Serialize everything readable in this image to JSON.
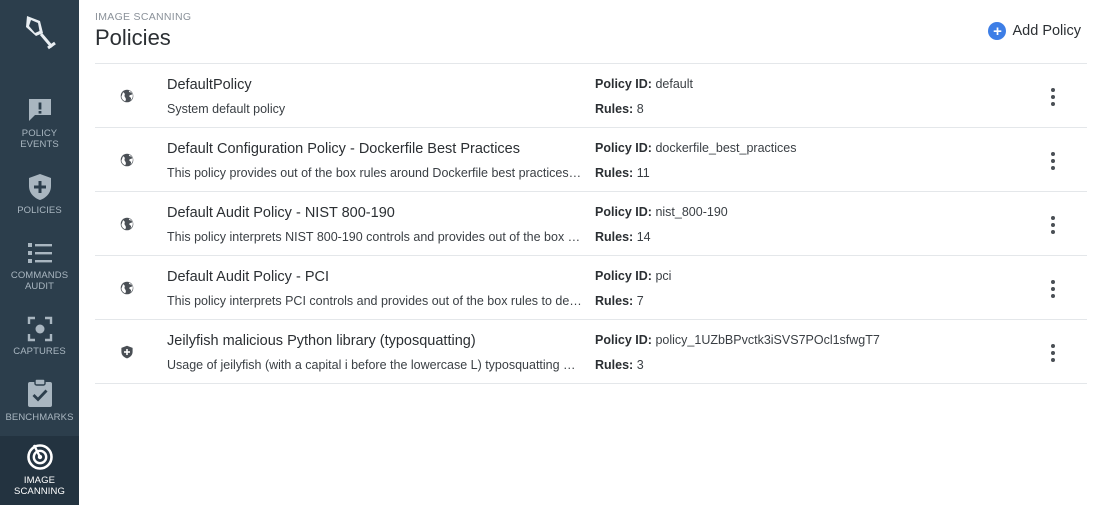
{
  "sidebar": {
    "items": [
      {
        "label": "Policy\nEvents",
        "icon": "chat-alert-icon"
      },
      {
        "label": "Policies",
        "icon": "shield-plus-icon"
      },
      {
        "label": "Commands\nAudit",
        "icon": "list-icon"
      },
      {
        "label": "Captures",
        "icon": "capture-focus-icon"
      },
      {
        "label": "Benchmarks",
        "icon": "clipboard-check-icon"
      },
      {
        "label": "Image\nScanning",
        "icon": "radar-icon",
        "active": true
      }
    ]
  },
  "header": {
    "breadcrumb": "IMAGE SCANNING",
    "title": "Policies",
    "add_label": "Add Policy"
  },
  "labels": {
    "policy_id": "Policy ID:",
    "rules": "Rules:"
  },
  "policies": [
    {
      "name": "DefaultPolicy",
      "description": "System default policy",
      "policy_id": "default",
      "rules": "8",
      "icon": "globe-icon"
    },
    {
      "name": "Default Configuration Policy - Dockerfile Best Practices",
      "description": "This policy provides out of the box rules around Dockerfile best practices…",
      "policy_id": "dockerfile_best_practices",
      "rules": "11",
      "icon": "globe-icon"
    },
    {
      "name": "Default Audit Policy - NIST 800-190",
      "description": "This policy interprets NIST 800-190 controls and provides out of the box …",
      "policy_id": "nist_800-190",
      "rules": "14",
      "icon": "globe-icon"
    },
    {
      "name": "Default Audit Policy - PCI",
      "description": "This policy interprets PCI controls and provides out of the box rules to de…",
      "policy_id": "pci",
      "rules": "7",
      "icon": "globe-icon"
    },
    {
      "name": "Jeilyfish malicious Python library (typosquatting)",
      "description": "Usage of jeilyfish (with a capital i before the lowercase L) typosquatting …",
      "policy_id": "policy_1UZbBPvctk3iSVS7POcl1sfwgT7",
      "rules": "3",
      "icon": "shield-icon"
    }
  ],
  "colors": {
    "sidebar_bg": "#2c3e4c",
    "accent": "#3d7ee6"
  }
}
